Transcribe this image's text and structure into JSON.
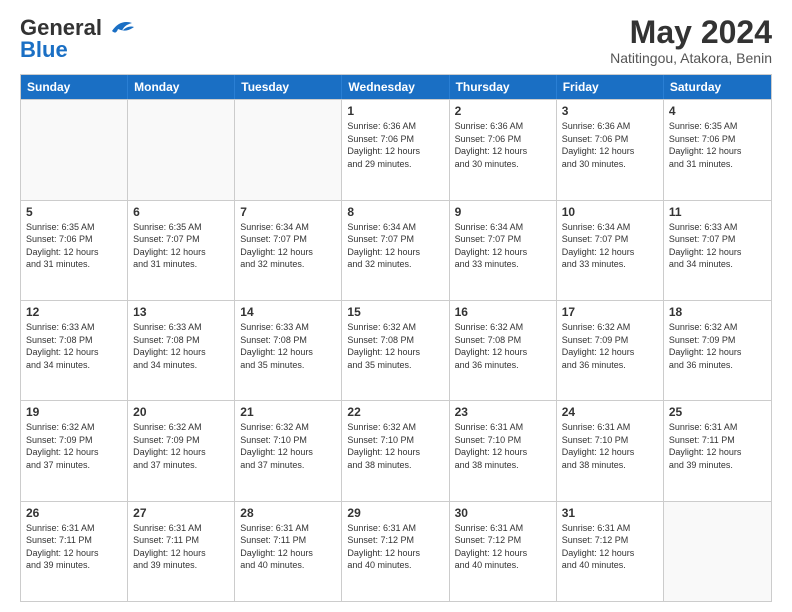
{
  "header": {
    "logo_line1": "General",
    "logo_line2": "Blue",
    "month": "May 2024",
    "location": "Natitingou, Atakora, Benin"
  },
  "days_of_week": [
    "Sunday",
    "Monday",
    "Tuesday",
    "Wednesday",
    "Thursday",
    "Friday",
    "Saturday"
  ],
  "weeks": [
    [
      {
        "day": "",
        "info": ""
      },
      {
        "day": "",
        "info": ""
      },
      {
        "day": "",
        "info": ""
      },
      {
        "day": "1",
        "info": "Sunrise: 6:36 AM\nSunset: 7:06 PM\nDaylight: 12 hours\nand 29 minutes."
      },
      {
        "day": "2",
        "info": "Sunrise: 6:36 AM\nSunset: 7:06 PM\nDaylight: 12 hours\nand 30 minutes."
      },
      {
        "day": "3",
        "info": "Sunrise: 6:36 AM\nSunset: 7:06 PM\nDaylight: 12 hours\nand 30 minutes."
      },
      {
        "day": "4",
        "info": "Sunrise: 6:35 AM\nSunset: 7:06 PM\nDaylight: 12 hours\nand 31 minutes."
      }
    ],
    [
      {
        "day": "5",
        "info": "Sunrise: 6:35 AM\nSunset: 7:06 PM\nDaylight: 12 hours\nand 31 minutes."
      },
      {
        "day": "6",
        "info": "Sunrise: 6:35 AM\nSunset: 7:07 PM\nDaylight: 12 hours\nand 31 minutes."
      },
      {
        "day": "7",
        "info": "Sunrise: 6:34 AM\nSunset: 7:07 PM\nDaylight: 12 hours\nand 32 minutes."
      },
      {
        "day": "8",
        "info": "Sunrise: 6:34 AM\nSunset: 7:07 PM\nDaylight: 12 hours\nand 32 minutes."
      },
      {
        "day": "9",
        "info": "Sunrise: 6:34 AM\nSunset: 7:07 PM\nDaylight: 12 hours\nand 33 minutes."
      },
      {
        "day": "10",
        "info": "Sunrise: 6:34 AM\nSunset: 7:07 PM\nDaylight: 12 hours\nand 33 minutes."
      },
      {
        "day": "11",
        "info": "Sunrise: 6:33 AM\nSunset: 7:07 PM\nDaylight: 12 hours\nand 34 minutes."
      }
    ],
    [
      {
        "day": "12",
        "info": "Sunrise: 6:33 AM\nSunset: 7:08 PM\nDaylight: 12 hours\nand 34 minutes."
      },
      {
        "day": "13",
        "info": "Sunrise: 6:33 AM\nSunset: 7:08 PM\nDaylight: 12 hours\nand 34 minutes."
      },
      {
        "day": "14",
        "info": "Sunrise: 6:33 AM\nSunset: 7:08 PM\nDaylight: 12 hours\nand 35 minutes."
      },
      {
        "day": "15",
        "info": "Sunrise: 6:32 AM\nSunset: 7:08 PM\nDaylight: 12 hours\nand 35 minutes."
      },
      {
        "day": "16",
        "info": "Sunrise: 6:32 AM\nSunset: 7:08 PM\nDaylight: 12 hours\nand 36 minutes."
      },
      {
        "day": "17",
        "info": "Sunrise: 6:32 AM\nSunset: 7:09 PM\nDaylight: 12 hours\nand 36 minutes."
      },
      {
        "day": "18",
        "info": "Sunrise: 6:32 AM\nSunset: 7:09 PM\nDaylight: 12 hours\nand 36 minutes."
      }
    ],
    [
      {
        "day": "19",
        "info": "Sunrise: 6:32 AM\nSunset: 7:09 PM\nDaylight: 12 hours\nand 37 minutes."
      },
      {
        "day": "20",
        "info": "Sunrise: 6:32 AM\nSunset: 7:09 PM\nDaylight: 12 hours\nand 37 minutes."
      },
      {
        "day": "21",
        "info": "Sunrise: 6:32 AM\nSunset: 7:10 PM\nDaylight: 12 hours\nand 37 minutes."
      },
      {
        "day": "22",
        "info": "Sunrise: 6:32 AM\nSunset: 7:10 PM\nDaylight: 12 hours\nand 38 minutes."
      },
      {
        "day": "23",
        "info": "Sunrise: 6:31 AM\nSunset: 7:10 PM\nDaylight: 12 hours\nand 38 minutes."
      },
      {
        "day": "24",
        "info": "Sunrise: 6:31 AM\nSunset: 7:10 PM\nDaylight: 12 hours\nand 38 minutes."
      },
      {
        "day": "25",
        "info": "Sunrise: 6:31 AM\nSunset: 7:11 PM\nDaylight: 12 hours\nand 39 minutes."
      }
    ],
    [
      {
        "day": "26",
        "info": "Sunrise: 6:31 AM\nSunset: 7:11 PM\nDaylight: 12 hours\nand 39 minutes."
      },
      {
        "day": "27",
        "info": "Sunrise: 6:31 AM\nSunset: 7:11 PM\nDaylight: 12 hours\nand 39 minutes."
      },
      {
        "day": "28",
        "info": "Sunrise: 6:31 AM\nSunset: 7:11 PM\nDaylight: 12 hours\nand 40 minutes."
      },
      {
        "day": "29",
        "info": "Sunrise: 6:31 AM\nSunset: 7:12 PM\nDaylight: 12 hours\nand 40 minutes."
      },
      {
        "day": "30",
        "info": "Sunrise: 6:31 AM\nSunset: 7:12 PM\nDaylight: 12 hours\nand 40 minutes."
      },
      {
        "day": "31",
        "info": "Sunrise: 6:31 AM\nSunset: 7:12 PM\nDaylight: 12 hours\nand 40 minutes."
      },
      {
        "day": "",
        "info": ""
      }
    ]
  ]
}
